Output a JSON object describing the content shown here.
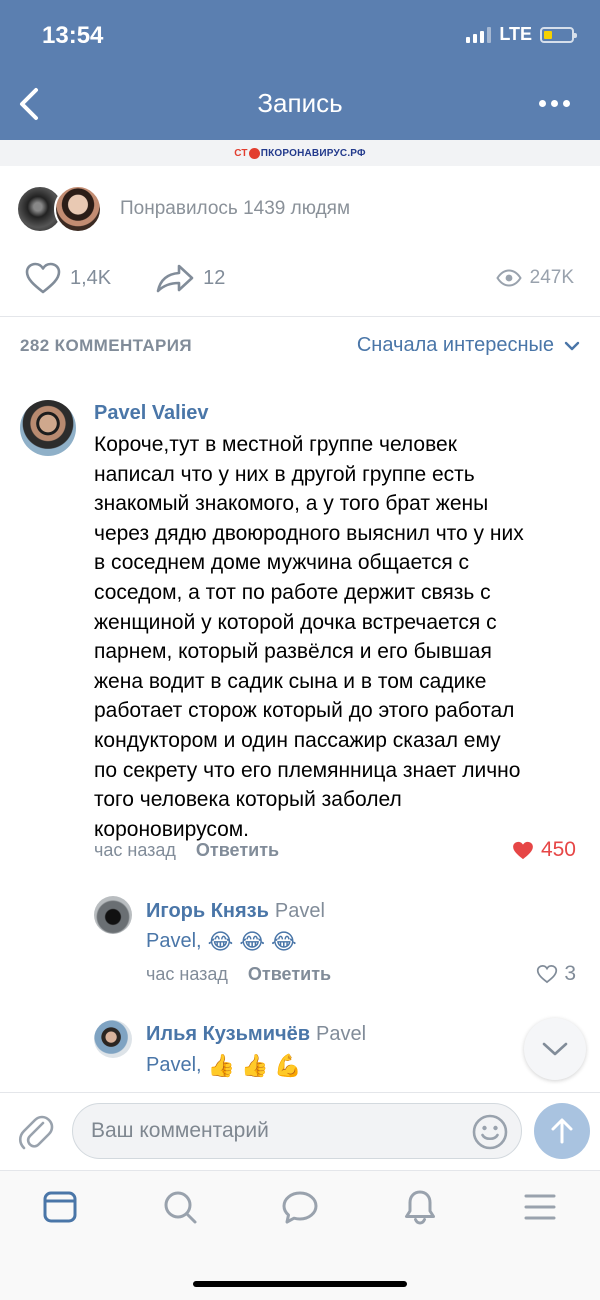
{
  "status_bar": {
    "time": "13:54",
    "network": "LTE"
  },
  "header": {
    "title": "Запись"
  },
  "banner": {
    "part1": "СТ",
    "part2": "ПКОРОНАВИРУС.РФ"
  },
  "post": {
    "likers_text": "Понравилось 1439 людям",
    "likes": "1,4K",
    "shares": "12",
    "views": "247K"
  },
  "comments_section": {
    "count_label": "282 КОММЕНТАРИЯ",
    "sort_label": "Сначала интересные"
  },
  "comments": [
    {
      "author": "Pavel Valiev",
      "text": "Короче,тут в местной группе человек\nнаписал что у них в другой группе есть\nзнакомый знакомого, а у того брат жены\nчерез дядю двоюродного выяснил что у них\nв соседнем доме мужчина общается с\nсоседом, а тот по работе держит связь с\nженщиной у которой дочка встречается с\nпарнем, который развёлся и его бывшая\nжена водит в садик сына и в том садике\nработает сторож который до этого работал\nкондуктором и один пассажир сказал ему\nпо секрету что его племянница знает лично\nтого человека который заболел\nкороновирусом.",
      "time": "час назад",
      "reply_label": "Ответить",
      "likes": "450"
    }
  ],
  "replies": [
    {
      "author": "Игорь Князь",
      "reply_to": "Pavel",
      "text": "Pavel,",
      "emoji": [
        "😂",
        "😂",
        "😂"
      ],
      "time": "час назад",
      "reply_label": "Ответить",
      "likes": "3"
    },
    {
      "author": "Илья Кузьмичёв",
      "reply_to": "Pavel",
      "text": "Pavel,",
      "emoji": [
        "👍",
        "👍",
        "💪"
      ]
    }
  ],
  "composer": {
    "placeholder": "Ваш комментарий"
  },
  "colors": {
    "header": "#5b7fb0",
    "link": "#4a76a8",
    "heart": "#e64646",
    "muted": "#818c99"
  },
  "icons": {
    "tabs": [
      "news-feed-icon",
      "search-icon",
      "messages-icon",
      "notifications-icon",
      "menu-icon"
    ]
  }
}
